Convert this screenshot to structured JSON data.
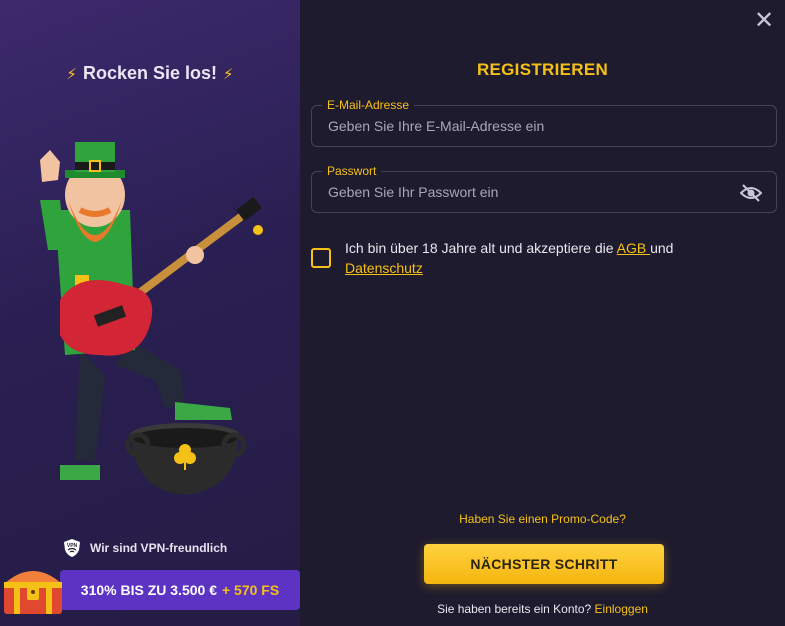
{
  "left": {
    "tagline": "Rocken Sie los!",
    "bolt": "⚡",
    "vpn_text": "Wir sind VPN-freundlich",
    "vpn_badge": "VPN",
    "bonus_main": "310% BIS ZU 3.500 €",
    "bonus_fs": "+ 570 FS"
  },
  "form": {
    "title": "REGISTRIEREN",
    "email": {
      "label": "E-Mail-Adresse",
      "placeholder": "Geben Sie Ihre E-Mail-Adresse ein",
      "value": ""
    },
    "password": {
      "label": "Passwort",
      "placeholder": "Geben Sie Ihr Passwort ein",
      "value": ""
    },
    "consent": {
      "text_before": "Ich bin über 18 Jahre alt und akzeptiere die ",
      "agb_link": "AGB ",
      "text_middle": "und ",
      "privacy_link": "Datenschutz",
      "checked": false
    },
    "promo_code_link": "Haben Sie einen Promo-Code?",
    "next_button": "NÄCHSTER SCHRITT",
    "login_prompt": "Sie haben bereits ein Konto?",
    "login_link": "Einloggen",
    "close_glyph": "✕"
  },
  "colors": {
    "accent": "#f5c116",
    "background": "#1e1b2e",
    "left_panel": "#2a1f52",
    "bonus_bar": "#5d33c4"
  }
}
